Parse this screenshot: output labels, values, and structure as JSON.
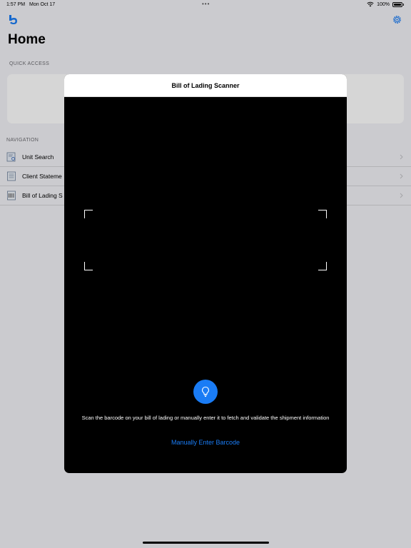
{
  "status_bar": {
    "time": "1:57 PM",
    "date": "Mon Oct 17",
    "battery": "100%"
  },
  "home": {
    "title": "Home",
    "quick_access_header": "QUICK ACCESS",
    "navigation_header": "NAVIGATION",
    "nav_items": [
      {
        "label": "Unit Search",
        "icon": "document-search-icon"
      },
      {
        "label": "Client Stateme",
        "icon": "document-list-icon"
      },
      {
        "label": "Bill of Lading S",
        "icon": "barcode-document-icon"
      }
    ]
  },
  "modal": {
    "title": "Bill of Lading Scanner",
    "instructions": "Scan the barcode on your bill of lading or manually enter it to fetch and validate the shipment information",
    "manual_button": "Manually Enter Barcode",
    "torch_icon": "lightbulb-icon"
  },
  "colors": {
    "accent": "#1a7cf5",
    "scanner_background": "#000000",
    "page_background": "#f2f2f7"
  }
}
